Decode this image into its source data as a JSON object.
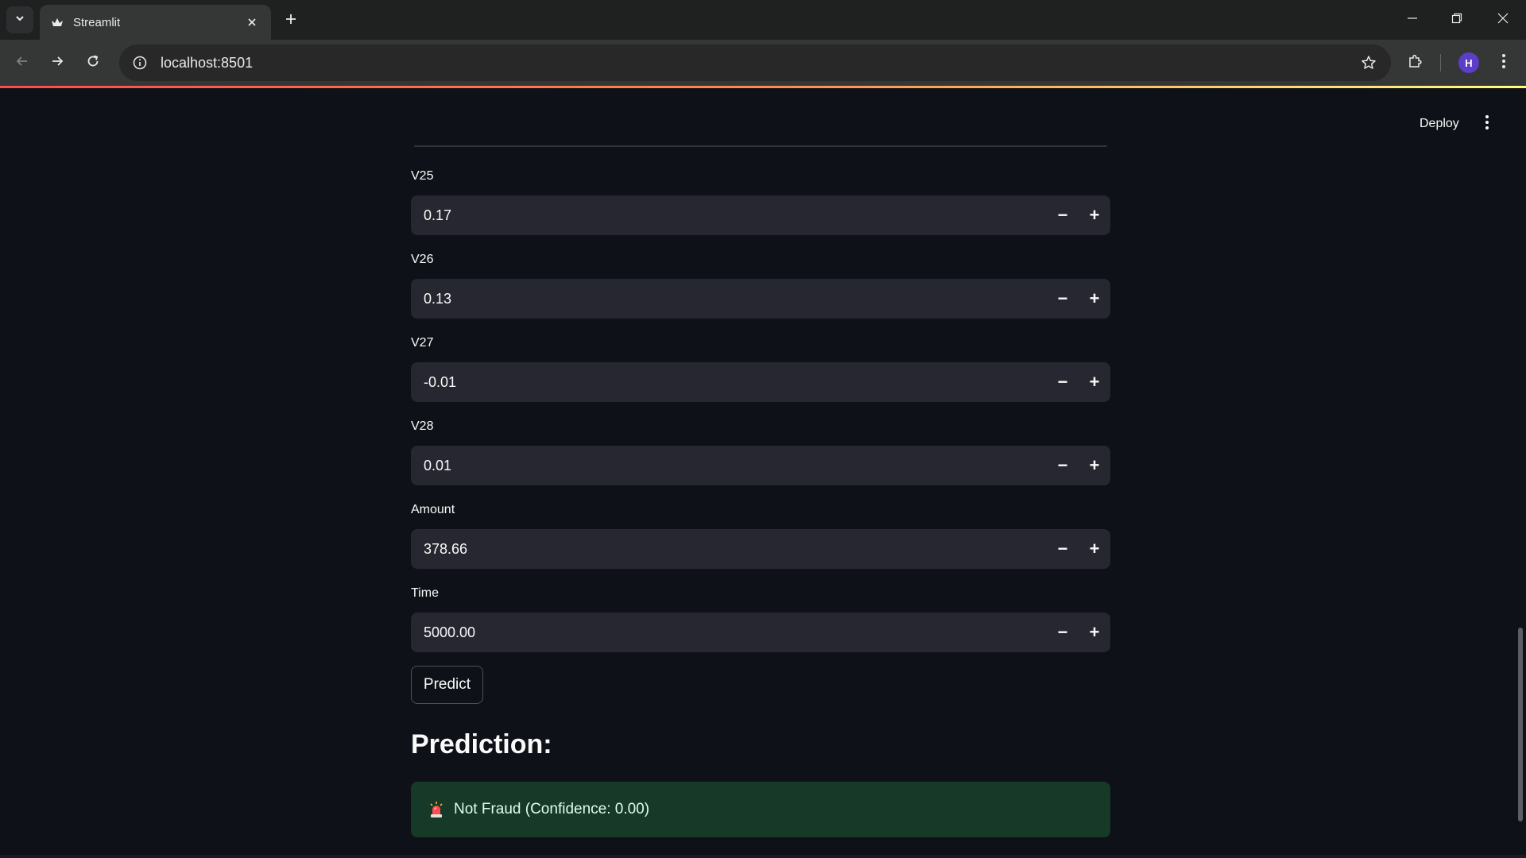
{
  "browser": {
    "tab_title": "Streamlit",
    "url": "localhost:8501",
    "profile_initial": "H"
  },
  "header": {
    "deploy_label": "Deploy"
  },
  "fields": [
    {
      "label": "V25",
      "value": "0.17"
    },
    {
      "label": "V26",
      "value": "0.13"
    },
    {
      "label": "V27",
      "value": "-0.01"
    },
    {
      "label": "V28",
      "value": "0.01"
    },
    {
      "label": "Amount",
      "value": "378.66"
    },
    {
      "label": "Time",
      "value": "5000.00"
    }
  ],
  "stepper": {
    "minus": "−",
    "plus": "+"
  },
  "predict_label": "Predict",
  "prediction": {
    "heading": "Prediction:",
    "result_text": "Not Fraud (Confidence: 0.00)",
    "icon": "siren-icon"
  },
  "colors": {
    "background": "#0e1117",
    "input_bg": "#262730",
    "success_bg": "#173928",
    "accent_red": "#ff4b4b"
  }
}
